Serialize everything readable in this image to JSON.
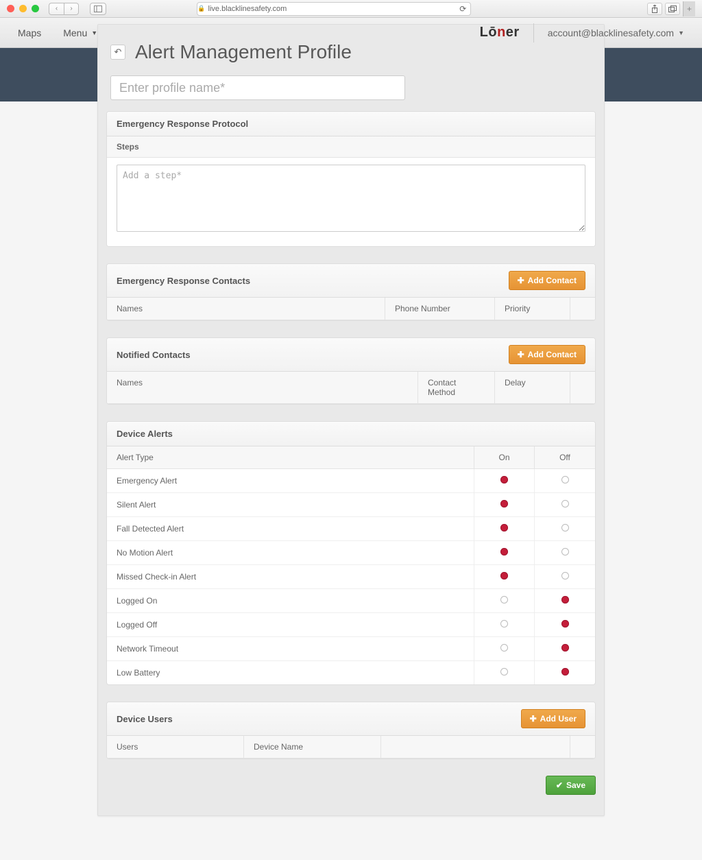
{
  "browser": {
    "address": "live.blacklinesafety.com"
  },
  "appbar": {
    "maps": "Maps",
    "menu": "Menu",
    "logo_pre": "L",
    "logo_mid": "ō",
    "logo_red": "n",
    "logo_post": "er",
    "account": "account@blacklinesafety.com"
  },
  "page": {
    "title": "Alert Management Profile",
    "profile_name_placeholder": "Enter profile name*"
  },
  "erp": {
    "title": "Emergency Response Protocol",
    "steps_label": "Steps",
    "steps_placeholder": "Add a step*"
  },
  "erc": {
    "title": "Emergency Response Contacts",
    "add_btn": "Add Contact",
    "col_names": "Names",
    "col_phone": "Phone Number",
    "col_priority": "Priority"
  },
  "nc": {
    "title": "Notified Contacts",
    "add_btn": "Add Contact",
    "col_names": "Names",
    "col_method": "Contact Method",
    "col_delay": "Delay"
  },
  "da": {
    "title": "Device Alerts",
    "col_type": "Alert Type",
    "col_on": "On",
    "col_off": "Off",
    "rows": [
      {
        "label": "Emergency Alert",
        "state": "on"
      },
      {
        "label": "Silent Alert",
        "state": "on"
      },
      {
        "label": "Fall Detected Alert",
        "state": "on"
      },
      {
        "label": "No Motion Alert",
        "state": "on"
      },
      {
        "label": "Missed Check-in Alert",
        "state": "on"
      },
      {
        "label": "Logged On",
        "state": "off"
      },
      {
        "label": "Logged Off",
        "state": "off"
      },
      {
        "label": "Network Timeout",
        "state": "off"
      },
      {
        "label": "Low Battery",
        "state": "off"
      }
    ]
  },
  "du": {
    "title": "Device Users",
    "add_btn": "Add User",
    "col_users": "Users",
    "col_device": "Device Name"
  },
  "footer": {
    "save": "Save"
  }
}
